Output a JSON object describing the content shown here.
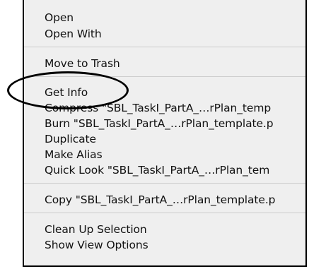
{
  "menu": {
    "items": [
      "Open",
      "Open With",
      "Move to Trash",
      "Get Info",
      "Compress \"SBL_TaskI_PartA_…rPlan_temp",
      "Burn \"SBL_TaskI_PartA_…rPlan_template.p",
      "Duplicate",
      "Make Alias",
      "Quick Look \"SBL_TaskI_PartA_…rPlan_tem",
      "Copy \"SBL_TaskI_PartA_…rPlan_template.p",
      "Clean Up Selection",
      "Show View Options"
    ]
  },
  "colors": {
    "menu_background": "#efefef",
    "separator": "#cdcdcd",
    "annotation": "#000000"
  }
}
